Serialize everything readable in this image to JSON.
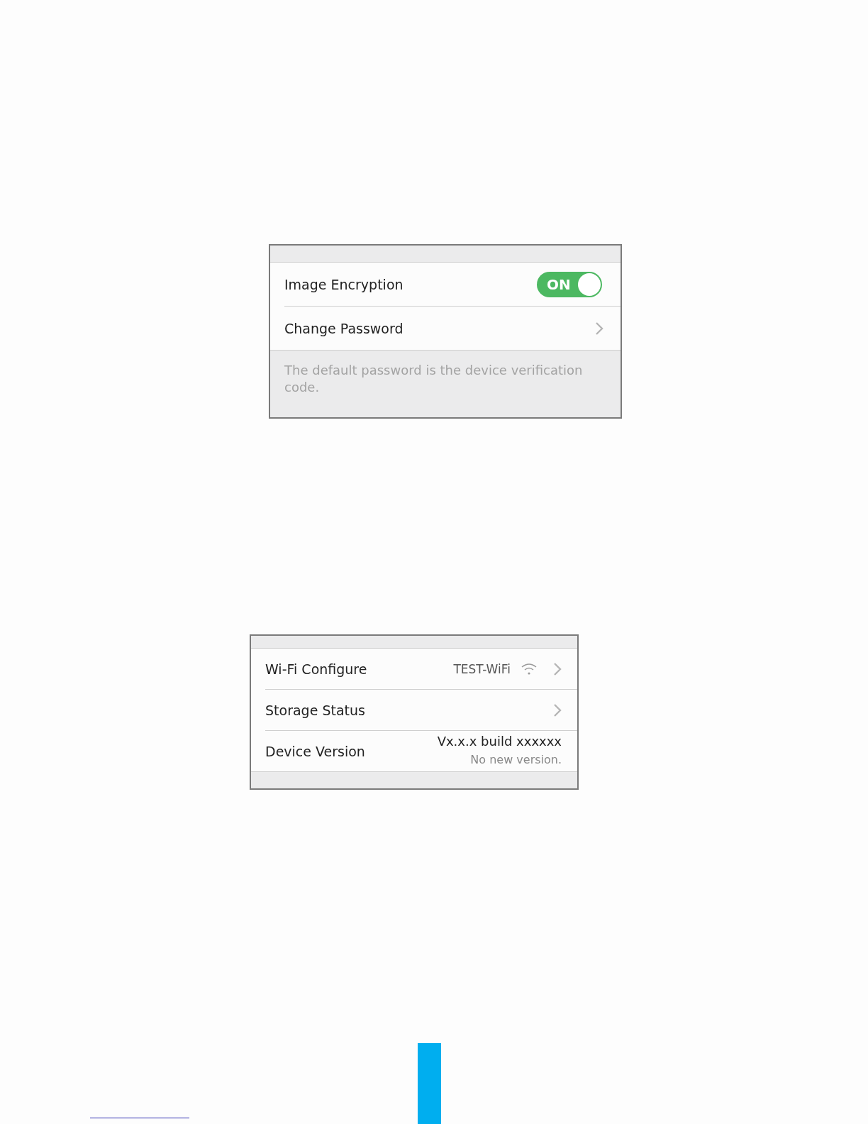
{
  "security_panel": {
    "rows": [
      {
        "kind": "toggle",
        "label": "Image Encryption",
        "toggle": {
          "on": true,
          "text": "ON"
        }
      },
      {
        "kind": "link",
        "label": "Change Password"
      }
    ],
    "note": "The default password is the device verification code."
  },
  "device_panel": {
    "rows": [
      {
        "kind": "link",
        "label": "Wi-Fi Configure",
        "value": "TEST-WiFi"
      },
      {
        "kind": "link",
        "label": "Storage Status"
      },
      {
        "kind": "version",
        "label": "Device Version",
        "version": "Vx.x.x build xxxxxx",
        "status": "No new version."
      }
    ]
  }
}
